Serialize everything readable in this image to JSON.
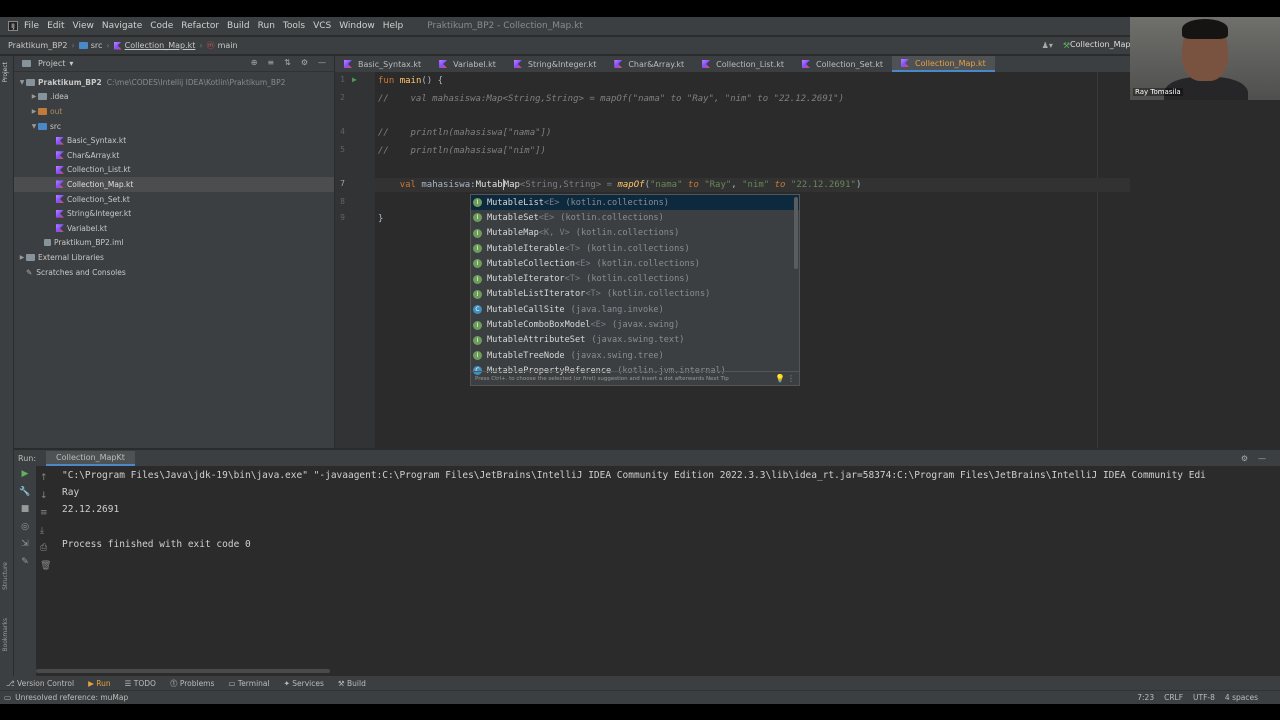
{
  "window": {
    "title": "Praktikum_BP2 - Collection_Map.kt"
  },
  "menu": [
    "File",
    "Edit",
    "View",
    "Navigate",
    "Code",
    "Refactor",
    "Build",
    "Run",
    "Tools",
    "VCS",
    "Window",
    "Help"
  ],
  "breadcrumb": {
    "project": "Praktikum_BP2",
    "folder": "src",
    "file": "Collection_Map.kt",
    "func": "main"
  },
  "run_config": "Collection_MapKt",
  "project_panel": {
    "title": "Project",
    "root": "Praktikum_BP2",
    "root_path": "C:\\me\\CODES\\Intellij IDEA\\Kotlin\\Praktikum_BP2",
    "items": [
      ".idea",
      "out",
      "src",
      "Basic_Syntax.kt",
      "Char&Array.kt",
      "Collection_List.kt",
      "Collection_Map.kt",
      "Collection_Set.kt",
      "String&Integer.kt",
      "Variabel.kt",
      "Praktikum_BP2.iml",
      "External Libraries",
      "Scratches and Consoles"
    ]
  },
  "editor_tabs": [
    "Basic_Syntax.kt",
    "Variabel.kt",
    "String&Integer.kt",
    "Char&Array.kt",
    "Collection_List.kt",
    "Collection_Set.kt",
    "Collection_Map.kt"
  ],
  "code": {
    "l1_kw": "fun",
    "l1_fn": "main",
    "l1_rest": "() {",
    "l2": "//    val mahasiswa:Map<String,String> = mapOf(\"nama\" to \"Ray\", \"nim\" to \"22.12.2691\")",
    "l4": "//    println(mahasiswa[\"nama\"])",
    "l5": "//    println(mahasiswa[\"nim\"])",
    "l7_kw": "val",
    "l7_var": " mahasiswa:",
    "l7_typed": "Mutab",
    "l7_after": "Map",
    "l7_generic": "<String,String> = ",
    "l7_fn": "mapOf",
    "l7_rest1": "(",
    "l7_s1": "\"nama\"",
    "l7_to1": " to ",
    "l7_s2": "\"Ray\"",
    "l7_comma": ", ",
    "l7_s3": "\"nim\"",
    "l7_to2": " to ",
    "l7_s4": "\"22.12.2691\"",
    "l7_close": ")",
    "l9": "}"
  },
  "line_numbers": [
    "1",
    "2",
    "",
    "4",
    "5",
    "",
    "7",
    "8",
    "9"
  ],
  "completion": {
    "items": [
      {
        "name": "MutableList",
        "type": "<E>",
        "pkg": "(kotlin.collections)",
        "icon": "I"
      },
      {
        "name": "MutableSet",
        "type": "<E>",
        "pkg": "(kotlin.collections)",
        "icon": "I"
      },
      {
        "name": "MutableMap",
        "type": "<K, V>",
        "pkg": "(kotlin.collections)",
        "icon": "I"
      },
      {
        "name": "MutableIterable",
        "type": "<T>",
        "pkg": "(kotlin.collections)",
        "icon": "I"
      },
      {
        "name": "MutableCollection",
        "type": "<E>",
        "pkg": "(kotlin.collections)",
        "icon": "I"
      },
      {
        "name": "MutableIterator",
        "type": "<T>",
        "pkg": "(kotlin.collections)",
        "icon": "I"
      },
      {
        "name": "MutableListIterator",
        "type": "<T>",
        "pkg": "(kotlin.collections)",
        "icon": "I"
      },
      {
        "name": "MutableCallSite",
        "type": "",
        "pkg": "(java.lang.invoke)",
        "icon": "C"
      },
      {
        "name": "MutableComboBoxModel",
        "type": "<E>",
        "pkg": "(javax.swing)",
        "icon": "I"
      },
      {
        "name": "MutableAttributeSet",
        "type": "",
        "pkg": "(javax.swing.text)",
        "icon": "I"
      },
      {
        "name": "MutableTreeNode",
        "type": "",
        "pkg": "(javax.swing.tree)",
        "icon": "I"
      },
      {
        "name": "MutablePropertyReference",
        "type": "",
        "pkg": "(kotlin.jvm.internal)",
        "icon": "C"
      }
    ],
    "footer": "Press Ctrl+. to choose the selected (or first) suggestion and insert a dot afterwards  Next Tip"
  },
  "run_panel": {
    "label": "Run:",
    "tab": "Collection_MapKt",
    "output": [
      "\"C:\\Program Files\\Java\\jdk-19\\bin\\java.exe\" \"-javaagent:C:\\Program Files\\JetBrains\\IntelliJ IDEA Community Edition 2022.3.3\\lib\\idea_rt.jar=58374:C:\\Program Files\\JetBrains\\IntelliJ IDEA Community Edi",
      "Ray",
      "22.12.2691",
      "",
      "Process finished with exit code 0"
    ]
  },
  "bottom_tabs": [
    "Version Control",
    "Run",
    "TODO",
    "Problems",
    "Terminal",
    "Services",
    "Build"
  ],
  "status": {
    "message": "Unresolved reference: muMap",
    "position": "7:23",
    "line_sep": "CRLF",
    "encoding": "UTF-8",
    "indent": "4 spaces"
  },
  "webcam": {
    "name": "Ray Tomasila"
  },
  "side_labels": {
    "project": "Project",
    "structure": "Structure",
    "bookmarks": "Bookmarks"
  }
}
